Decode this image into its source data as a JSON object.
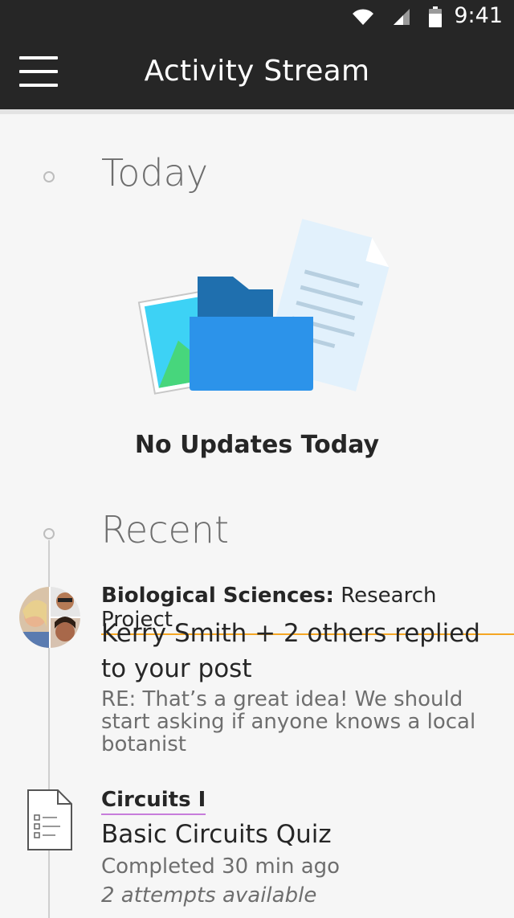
{
  "status_bar": {
    "time": "9:41",
    "icons": [
      "wifi-icon",
      "signal-icon",
      "battery-icon"
    ]
  },
  "app_bar": {
    "title": "Activity Stream",
    "menu_icon": "hamburger-menu-icon"
  },
  "today": {
    "heading": "Today",
    "empty_message": "No Updates Today",
    "illustration": "folder-documents-illustration"
  },
  "recent": {
    "heading": "Recent",
    "items": [
      {
        "course": "Biological Sciences:",
        "course_sub": "Research Project",
        "title": "Kerry Smith + 2 others replied to your post",
        "detail": "RE: That’s a great idea! We should start asking if anyone knows a local botanist",
        "icon": "avatar-group-icon",
        "accent_color": "#f5a623"
      },
      {
        "course": "Circuits I",
        "title": "Basic Circuits Quiz",
        "detail": "Completed 30 min ago",
        "note": "2 attempts available",
        "icon": "quiz-document-icon",
        "accent_color": "#c77ddb"
      }
    ]
  },
  "colors": {
    "header_bg": "#262626",
    "page_bg": "#f6f6f6",
    "text_primary": "#262626",
    "text_secondary": "#6e6e6e"
  }
}
